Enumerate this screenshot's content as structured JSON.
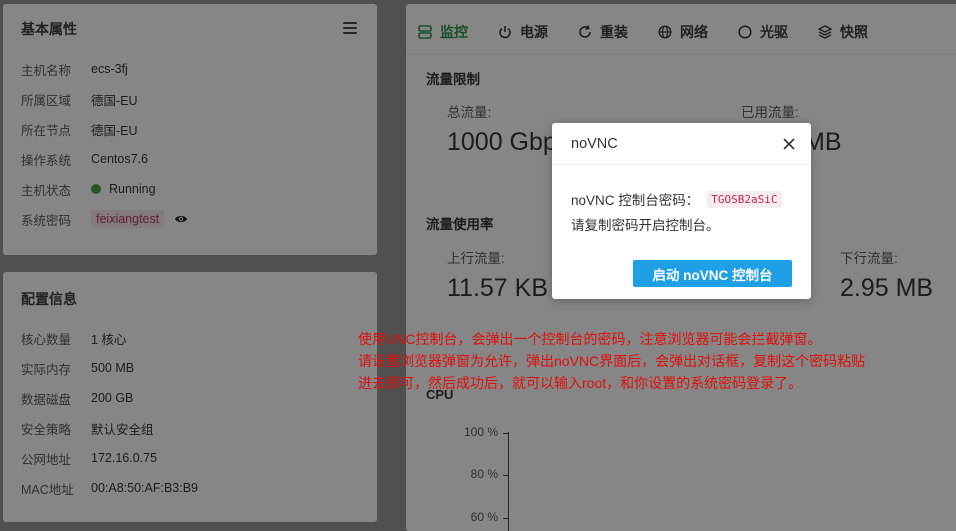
{
  "basic": {
    "title": "基本属性",
    "rows": [
      {
        "key": "主机名称",
        "value": "ecs-3fj"
      },
      {
        "key": "所属区域",
        "value": "德国-EU"
      },
      {
        "key": "所在节点",
        "value": "德国-EU"
      },
      {
        "key": "操作系统",
        "value": "Centos7.6"
      },
      {
        "key": "主机状态",
        "value": "Running"
      },
      {
        "key": "系统密码",
        "value": "feixiangtest"
      }
    ],
    "status_color": "#43a047"
  },
  "config": {
    "title": "配置信息",
    "rows": [
      {
        "key": "核心数量",
        "value": "1 核心"
      },
      {
        "key": "实际内存",
        "value": "500 MB"
      },
      {
        "key": "数据磁盘",
        "value": "200 GB"
      },
      {
        "key": "安全策略",
        "value": "默认安全组"
      },
      {
        "key": "公网地址",
        "value": "172.16.0.75"
      },
      {
        "key": "MAC地址",
        "value": "00:A8:50:AF:B3:B9"
      }
    ]
  },
  "tabs": [
    {
      "label": "监控",
      "icon": "monitor-icon"
    },
    {
      "label": "电源",
      "icon": "power-icon"
    },
    {
      "label": "重装",
      "icon": "refresh-icon"
    },
    {
      "label": "网络",
      "icon": "globe-icon"
    },
    {
      "label": "光驱",
      "icon": "disc-icon"
    },
    {
      "label": "快照",
      "icon": "layers-icon"
    }
  ],
  "traffic_limit": {
    "title": "流量限制",
    "total_label": "总流量:",
    "total_value": "1000 Gbp",
    "used_label": "已用流量:",
    "used_value": "MB"
  },
  "traffic_usage": {
    "title": "流量使用率",
    "up_label": "上行流量:",
    "up_value": "11.57 KB",
    "down_label": "下行流量:",
    "down_value": "2.95 MB"
  },
  "cpu_chart": {
    "title": "CPU",
    "ticks": [
      "100 %",
      "80 %",
      "60 %"
    ]
  },
  "modal": {
    "title": "noVNC",
    "password_label": "noVNC 控制台密码：",
    "password": "TGOSB2aSiC",
    "hint": "请复制密码开启控制台。",
    "button": "启动 noVNC 控制台"
  },
  "annotation": {
    "line1": "使用VNC控制台，会弹出一个控制台的密码，注意浏览器可能会拦截弹窗。",
    "line2": "请设置浏览器弹窗为允许，弹出noVNC界面后，会弹出对话框，复制这个密码粘贴",
    "line3": "进去即可，然后成功后，就可以输入root，和你设置的系统密码登录了。"
  },
  "colors": {
    "accent_green": "#2b8a4a",
    "button_blue": "#1f9fe6",
    "annotation_red": "#e0100e"
  }
}
